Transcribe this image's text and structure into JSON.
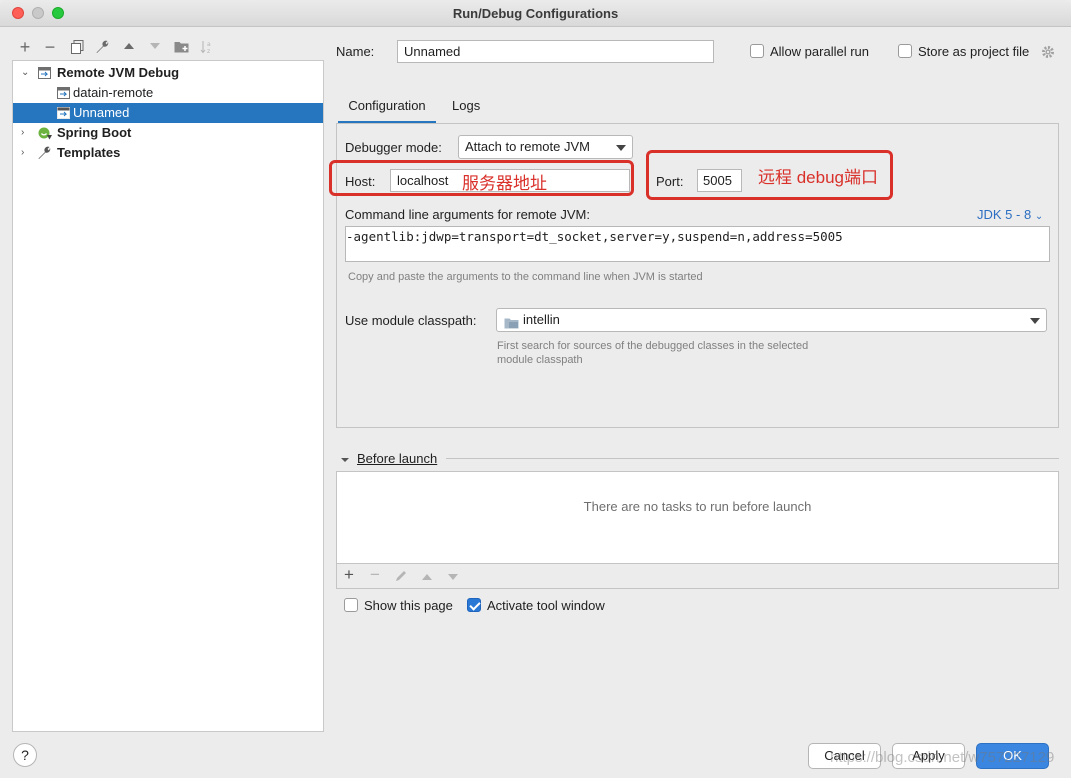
{
  "window": {
    "title": "Run/Debug Configurations"
  },
  "toolbar": {
    "add": "+",
    "remove": "−"
  },
  "tree": {
    "items": [
      {
        "label": "Remote JVM Debug"
      },
      {
        "label": "datain-remote"
      },
      {
        "label": "Unnamed"
      },
      {
        "label": "Spring Boot"
      },
      {
        "label": "Templates"
      }
    ]
  },
  "form": {
    "name_label": "Name:",
    "name_value": "Unnamed",
    "allow_parallel_label": "Allow parallel run",
    "store_project_label": "Store as project file",
    "tabs": [
      "Configuration",
      "Logs"
    ],
    "debugger_mode_label": "Debugger mode:",
    "debugger_mode_value": "Attach to remote JVM",
    "host_label": "Host:",
    "host_value": "localhost",
    "host_annotation": "服务器地址",
    "port_label": "Port:",
    "port_value": "5005",
    "port_annotation": "远程 debug端口",
    "cmd_label": "Command line arguments for remote JVM:",
    "jdk_link": "JDK 5 - 8",
    "cmd_value": "-agentlib:jdwp=transport=dt_socket,server=y,suspend=n,address=5005",
    "cmd_hint": "Copy and paste the arguments to the command line when JVM is started",
    "module_label": "Use module classpath:",
    "module_value": "intellin",
    "module_hint_1": "First search for sources of the debugged classes in the selected",
    "module_hint_2": "module classpath"
  },
  "before_launch": {
    "title": "Before launch",
    "empty_text": "There are no tasks to run before launch"
  },
  "options": {
    "show_page_label": "Show this page",
    "show_page_checked": false,
    "activate_tool_label": "Activate tool window",
    "activate_tool_checked": true
  },
  "buttons": {
    "help": "?",
    "cancel": "Cancel",
    "apply": "Apply",
    "ok": "OK"
  },
  "watermark": "https://blog.csdn.net/w757227129",
  "colors": {
    "selection": "#2675bf",
    "annotation": "#d9302a",
    "link": "#2b6fc2"
  }
}
